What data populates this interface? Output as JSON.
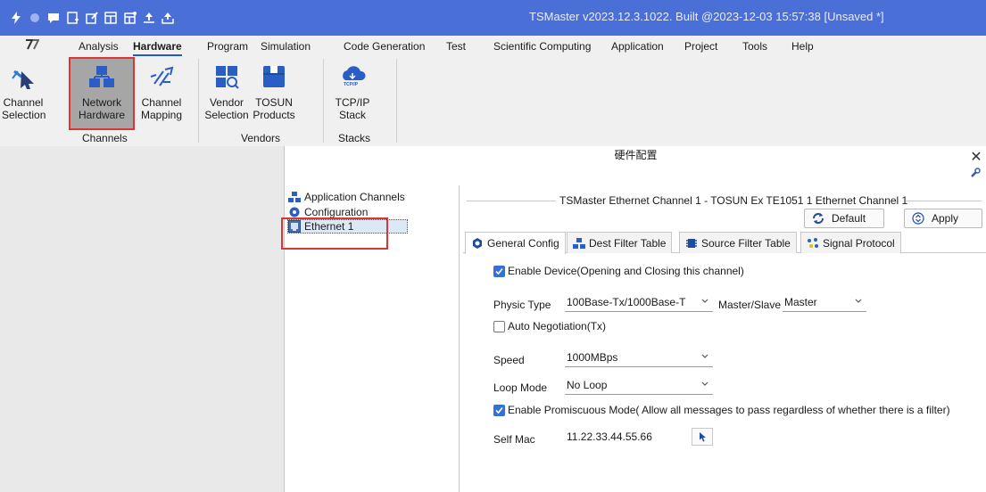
{
  "window": {
    "title": "TSMaster v2023.12.3.1022. Built @2023-12-03 15:57:38 [Unsaved *]",
    "quick_access_icons": [
      "flash-icon",
      "record-dot-icon",
      "message-icon",
      "window-add-icon",
      "window-edit-icon",
      "layout-icon",
      "layout-edit-icon",
      "upload-icon",
      "export-icon"
    ]
  },
  "menu": {
    "items": [
      "Analysis",
      "Hardware",
      "Program",
      "Simulation",
      "Code Generation",
      "Test",
      "Scientific Computing",
      "Application",
      "Project",
      "Tools",
      "Help"
    ],
    "active": "Hardware"
  },
  "ribbon": {
    "groups": [
      {
        "label": "Channels",
        "buttons": [
          {
            "line1": "Channel",
            "line2": "Selection",
            "icon": "cursor-pointer-icon"
          },
          {
            "line1": "Network",
            "line2": "Hardware",
            "icon": "network-hardware-icon",
            "selected": true
          },
          {
            "line1": "Channel",
            "line2": "Mapping",
            "icon": "channel-mapping-icon"
          }
        ]
      },
      {
        "label": "Vendors",
        "buttons": [
          {
            "line1": "Vendor",
            "line2": "Selection",
            "icon": "vendor-search-icon"
          },
          {
            "line1": "TOSUN",
            "line2": "Products",
            "icon": "tosun-box-icon"
          }
        ]
      },
      {
        "label": "Stacks",
        "buttons": [
          {
            "line1": "TCP/IP",
            "line2": "Stack",
            "icon": "tcpip-cloud-icon",
            "badge": "TCP/IP"
          }
        ]
      }
    ]
  },
  "dialog": {
    "title": "硬件配置",
    "tree": [
      {
        "label": "Application Channels",
        "icon": "network-icon"
      },
      {
        "label": "Configuration",
        "icon": "gear-icon"
      },
      {
        "label": "Ethernet 1",
        "icon": "ethernet-port-icon",
        "selected": true
      }
    ],
    "channel_title": "TSMaster Ethernet Channel 1 - TOSUN Ex TE1051 1 Ethernet Channel 1",
    "buttons": {
      "default": "Default",
      "apply": "Apply"
    },
    "tabs": [
      {
        "label": "General Config",
        "icon": "gear-badge-icon",
        "active": true
      },
      {
        "label": "Dest Filter Table",
        "icon": "network-icon"
      },
      {
        "label": "Source Filter Table",
        "icon": "chip-icon"
      },
      {
        "label": "Signal Protocol",
        "icon": "dots-icon"
      }
    ],
    "general": {
      "enable_device": {
        "label": "Enable Device(Opening and Closing this channel)",
        "checked": true
      },
      "physic_type": {
        "label": "Physic Type",
        "value": "100Base-Tx/1000Base-T"
      },
      "master_slave": {
        "label": "Master/Slave",
        "value": "Master"
      },
      "auto_negotiation": {
        "label": "Auto Negotiation(Tx)",
        "checked": false
      },
      "speed": {
        "label": "Speed",
        "value": "1000MBps"
      },
      "loop_mode": {
        "label": "Loop Mode",
        "value": "No Loop"
      },
      "promiscuous": {
        "label": "Enable Promiscuous Mode( Allow all messages to pass regardless of whether there is a filter)",
        "checked": true
      },
      "self_mac": {
        "label": "Self Mac",
        "value": "11.22.33.44.55.66"
      }
    }
  },
  "colors": {
    "titlebar": "#4a6fd6",
    "accent": "#3471d6",
    "highlight": "#d93636",
    "selected_button": "#a6a6a6"
  }
}
